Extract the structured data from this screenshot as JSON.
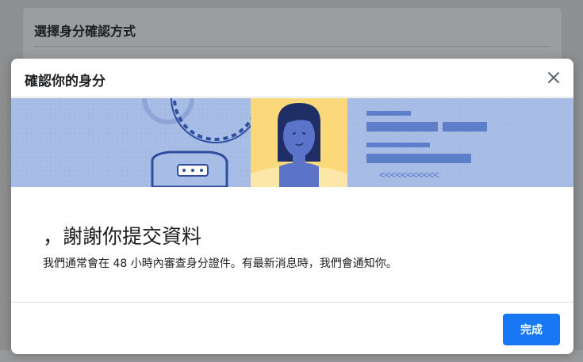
{
  "background_card": {
    "title": "選擇身分確認方式"
  },
  "modal": {
    "title": "確認你的身分",
    "close_icon": "close-icon",
    "banner": {
      "marks": "<<<<<<<<<<<"
    },
    "heading": "，謝謝你提交資料",
    "message": "我們通常會在 48 小時內審查身分證件。有最新消息時，我們會通知你。",
    "done_label": "完成"
  },
  "colors": {
    "primary": "#1877f2",
    "banner_blue": "#a7bde6",
    "banner_yellow": "#fbd97b",
    "illustration_dark": "#2e4e9d"
  }
}
